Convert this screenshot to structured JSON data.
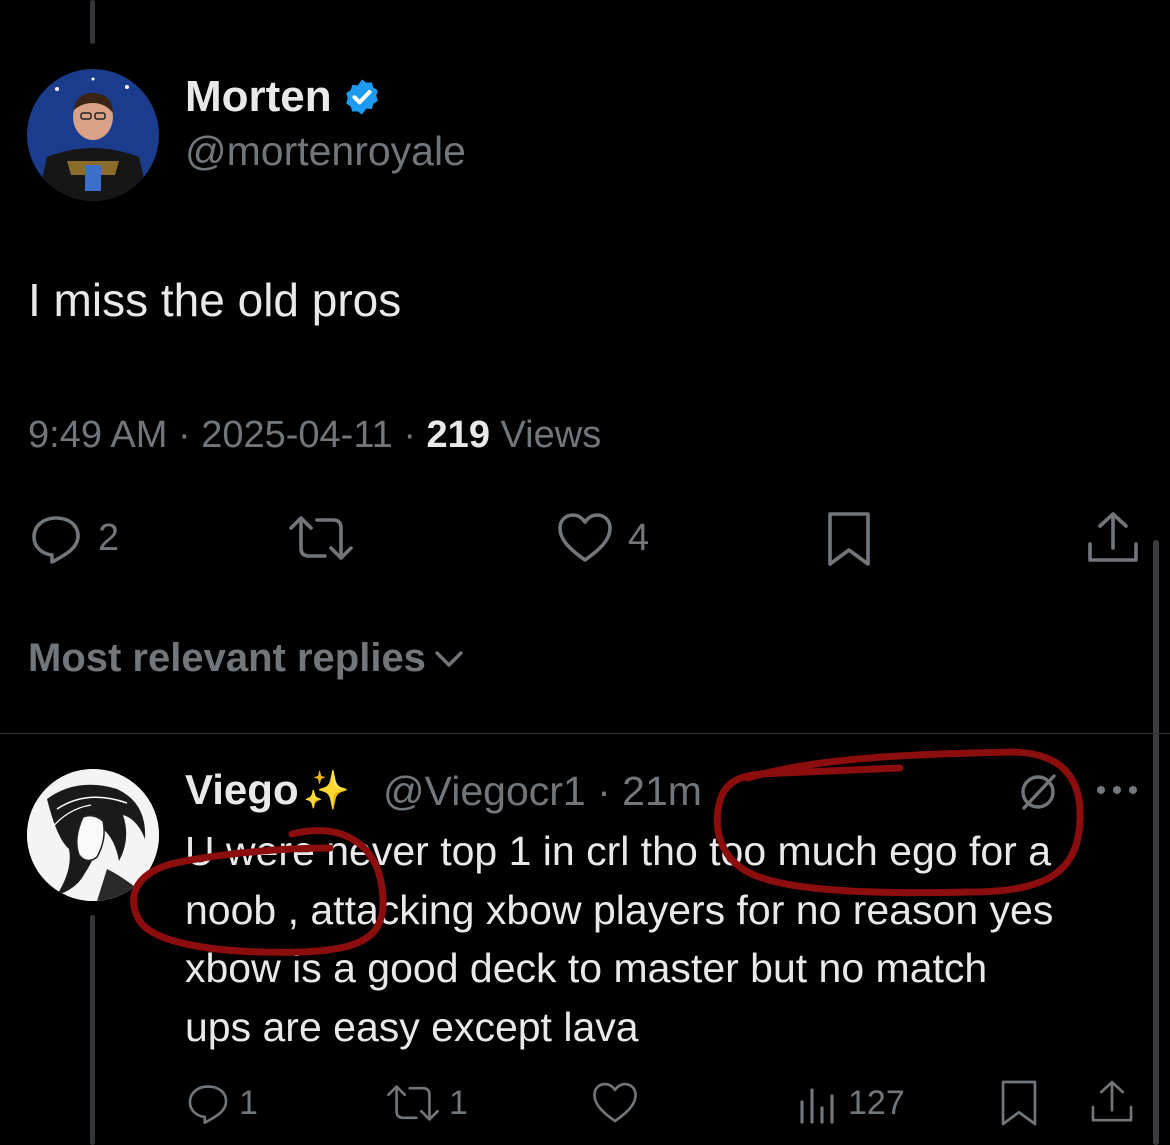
{
  "tweet": {
    "author_name": "Morten",
    "author_handle": "@mortenroyale",
    "verified": true,
    "text": "I miss the old pros",
    "time": "9:49 AM",
    "date": "2025-04-11",
    "views_count": "219",
    "views_label": "Views",
    "reply_count": "2",
    "like_count": "4",
    "icons": [
      "reply-icon",
      "retweet-icon",
      "like-icon",
      "bookmark-icon",
      "share-icon"
    ]
  },
  "replies_sort": {
    "label": "Most relevant replies"
  },
  "reply": {
    "author_name": "Viego",
    "author_emoji": "✨",
    "author_handle": "@Viegocr1",
    "time": "21m",
    "text_lines": [
      "U were never top 1 in crl tho too much ego for a",
      "noob , attacking xbow players for no reason yes",
      "xbow is a good deck to master but no match",
      "ups are easy except lava"
    ],
    "reply_count": "1",
    "retweet_count": "1",
    "views_count": "127",
    "icons": [
      "reply-icon",
      "retweet-icon",
      "like-icon",
      "views-icon",
      "bookmark-icon",
      "share-icon",
      "grok-icon",
      "more-icon"
    ]
  },
  "colors": {
    "background": "#000000",
    "text": "#e7e9ea",
    "secondary": "#71767b",
    "verified": "#1d9bf0",
    "annotation": "#8b0d0d"
  }
}
